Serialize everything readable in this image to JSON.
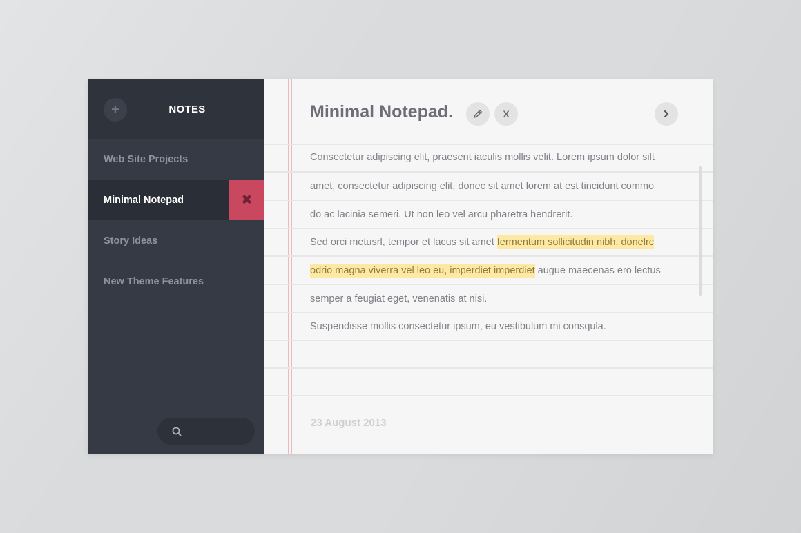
{
  "sidebar": {
    "title": "NOTES",
    "add_icon": "plus-icon",
    "items": [
      {
        "label": "Web Site Projects",
        "active": false
      },
      {
        "label": "Minimal Notepad",
        "active": true
      },
      {
        "label": "Story Ideas",
        "active": false
      },
      {
        "label": "New Theme Features",
        "active": false
      }
    ],
    "delete_icon": "close-icon",
    "search_icon": "search-icon"
  },
  "note": {
    "title": "Minimal Notepad.",
    "edit_icon": "pencil-icon",
    "close_label": "X",
    "next_icon": "chevron-right-icon",
    "paragraph1": [
      "Consectetur adipiscing elit, praesent iaculis mollis velit. Lorem ipsum dolor silt",
      "amet, consectetur adipiscing elit, donec sit amet lorem at est tincidunt commo",
      "do ac lacinia semeri. Ut non leo vel arcu pharetra hendrerit."
    ],
    "paragraph2_line1_plain": "Sed orci metusrl, tempor et lacus sit amet ",
    "paragraph2_line1_highlight": "fermentum sollicitudin nibh, donelrc",
    "paragraph2_line2_highlight": "odrio magna viverra vel leo eu, imperdiet imperdiet",
    "paragraph2_line2_plain": " augue maecenas ero lectus",
    "paragraph2_line3": "semper a feugiat eget, venenatis at nisi.",
    "paragraph3": "Suspendisse mollis consectetur ipsum, eu vestibulum mi consqula.",
    "date": "23 August 2013"
  },
  "colors": {
    "sidebar_bg": "#353a44",
    "accent_delete": "#c9485f",
    "highlight": "#fde8a4",
    "paper": "#f6f6f6"
  }
}
